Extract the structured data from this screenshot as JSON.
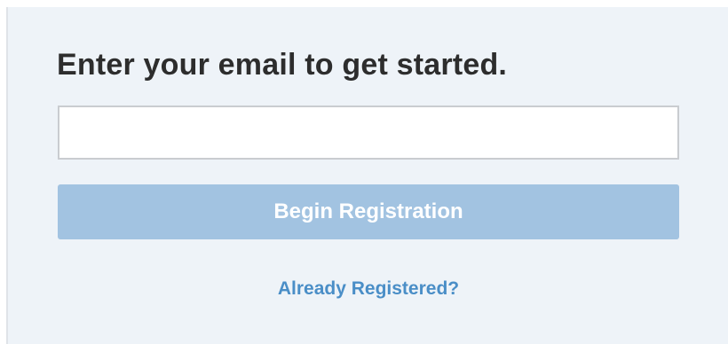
{
  "form": {
    "title": "Enter your email to get started.",
    "email": {
      "value": "",
      "placeholder": ""
    },
    "submit_label": "Begin Registration",
    "already_registered_label": "Already Registered?"
  },
  "colors": {
    "panel_background": "#eef3f8",
    "button_background": "#a2c3e1",
    "button_text": "#ffffff",
    "link": "#4a8ec7",
    "title_text": "#2d2d2d",
    "input_border": "#c9ccd0"
  }
}
